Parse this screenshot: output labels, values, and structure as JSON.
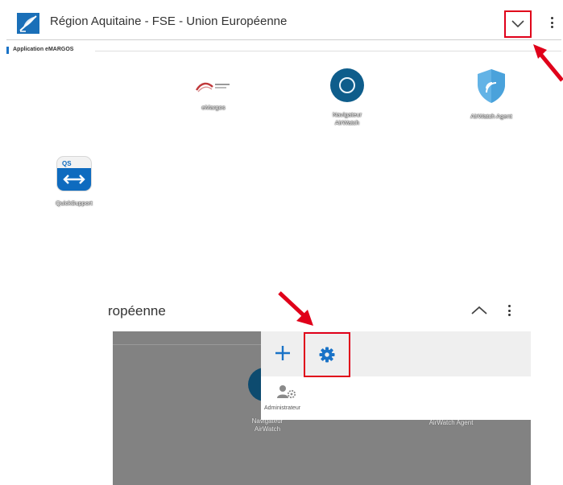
{
  "top_screen": {
    "header": {
      "title": "Région Aquitaine - FSE - Union Européenne",
      "logo_icon": "feather-logo-icon",
      "collapse_icon": "chevron-down-icon",
      "menu_icon": "more-vertical-icon"
    },
    "section": {
      "label": "Application eMARGOS"
    },
    "apps": [
      {
        "name": "eMargos",
        "icon": "nouvelle-aquitaine-logo-icon"
      },
      {
        "name": "Navigateur AirWatch",
        "icon": "compass-icon"
      },
      {
        "name": "AirWatch Agent",
        "icon": "shield-icon"
      },
      {
        "name": "QuickSupport",
        "icon": "quicksupport-icon"
      }
    ]
  },
  "bottom_screen": {
    "title_fragment": "ropéenne",
    "expand_icon": "chevron-up-icon",
    "menu_icon": "more-vertical-icon",
    "popup": {
      "add_icon": "plus-icon",
      "settings_icon": "gear-icon",
      "account": {
        "icon": "admin-user-gear-icon",
        "label": "Administrateur"
      }
    },
    "background_labels": [
      "Navigateur AirWatch",
      "AirWatch Agent"
    ]
  },
  "colors": {
    "highlight": "#e0001a",
    "accent_blue": "#1a73c7",
    "overlay": "#828282"
  }
}
